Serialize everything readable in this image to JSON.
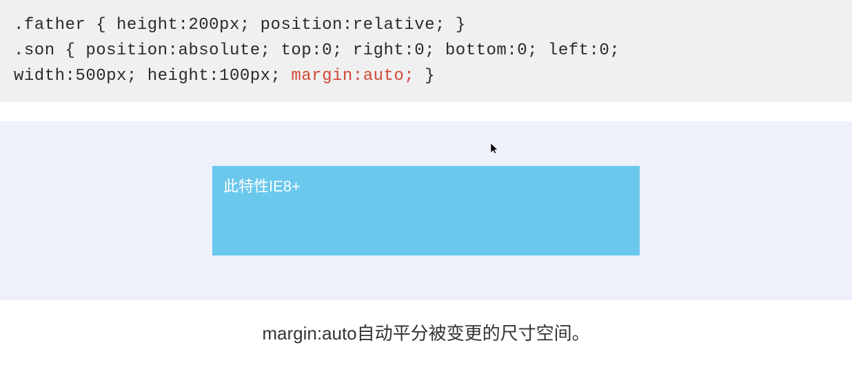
{
  "code": {
    "line1_before": ".father { height:200px; position:relative; }",
    "line2_before": ".son { position:absolute; top:0; right:0; bottom:0; left:0;",
    "line3_indent": "    width:500px; height:100px; ",
    "line3_highlight": "margin:auto;",
    "line3_after": " }"
  },
  "demo": {
    "son_text": "此特性IE8+"
  },
  "caption": "margin:auto自动平分被变更的尺寸空间。"
}
